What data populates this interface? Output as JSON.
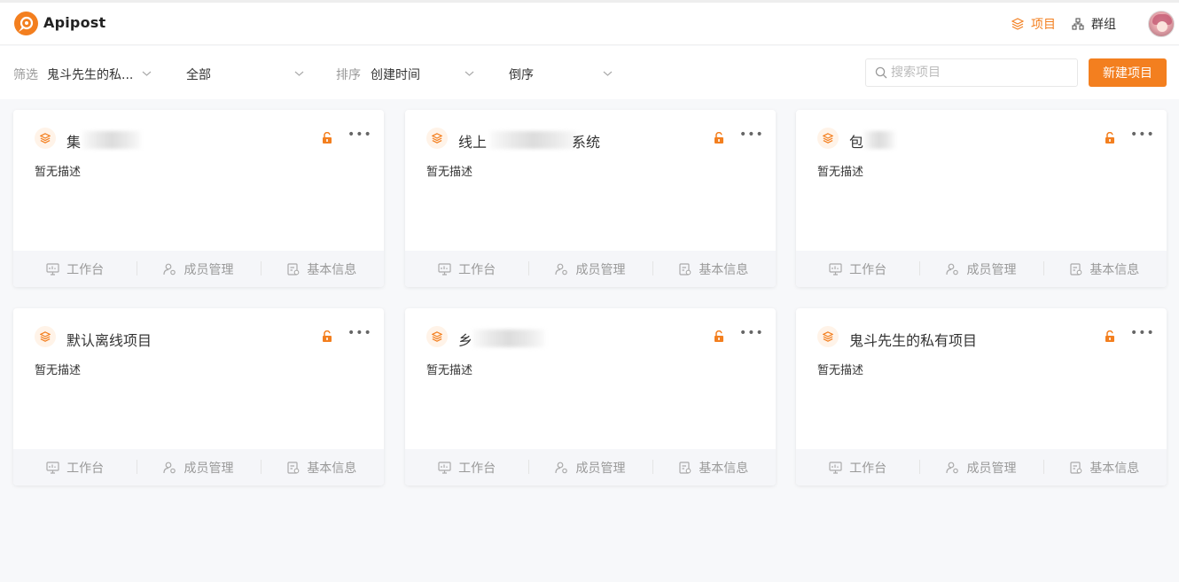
{
  "app": {
    "name": "Apipost"
  },
  "nav": {
    "projects": "项目",
    "groups": "群组"
  },
  "colors": {
    "accent": "#f37f1f"
  },
  "toolbar": {
    "filter_label": "筛选",
    "filter_owner": "鬼斗先生的私...",
    "filter_scope": "全部",
    "sort_label": "排序",
    "sort_field": "创建时间",
    "sort_order": "倒序",
    "search_placeholder": "搜索项目",
    "new_project_label": "新建项目"
  },
  "cards": [
    {
      "title": "集",
      "desc": "暂无描述",
      "locked": true,
      "blurred": true
    },
    {
      "title": "线上",
      "title_suffix": "系统",
      "desc": "暂无描述",
      "locked": true,
      "blurred": true
    },
    {
      "title": "包",
      "desc": "暂无描述",
      "locked": true,
      "blurred": true
    },
    {
      "title": "默认离线项目",
      "desc": "暂无描述",
      "locked": true,
      "blurred": false
    },
    {
      "title": "乡",
      "desc": "暂无描述",
      "locked": true,
      "blurred": true
    },
    {
      "title": "鬼斗先生的私有项目",
      "desc": "暂无描述",
      "locked": true,
      "blurred": false
    }
  ],
  "card_actions": {
    "workspace": "工作台",
    "members": "成员管理",
    "info": "基本信息"
  },
  "icons": [
    "logo-icon",
    "layers-icon",
    "org-icon",
    "chevron-down-icon",
    "search-icon",
    "unlock-icon",
    "more-icon",
    "monitor-icon",
    "member-settings-icon",
    "info-card-icon"
  ]
}
